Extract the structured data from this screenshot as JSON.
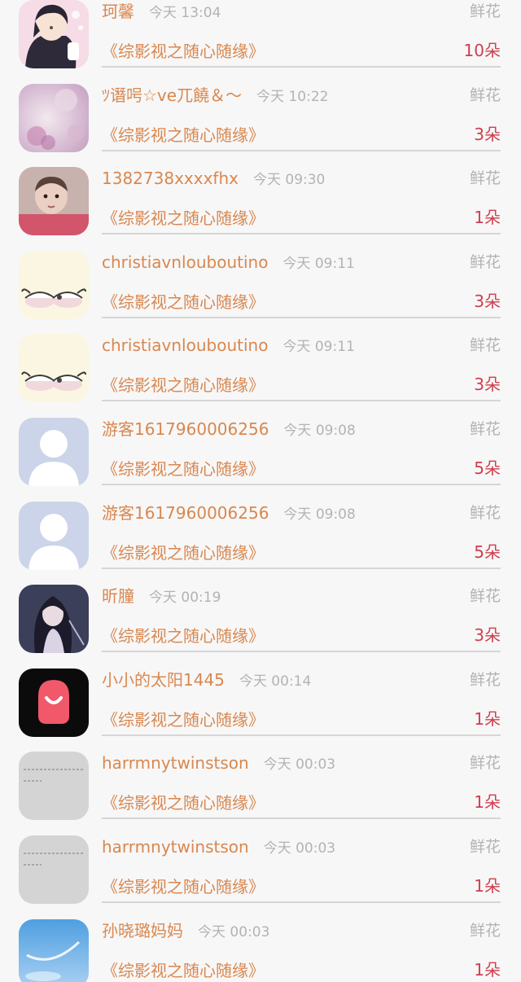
{
  "rows": [
    {
      "name": "珂馨",
      "time": "今天 13:04",
      "gift": "鲜花",
      "book": "《综影视之随心随缘》",
      "count": "10朵",
      "avatar_icon": "anime-boy-avatar"
    },
    {
      "name": "ﾂ谮呺☆ve兀饒＆～",
      "time": "今天 10:22",
      "gift": "鲜花",
      "book": "《综影视之随心随缘》",
      "count": "3朵",
      "avatar_icon": "flower-photo-avatar"
    },
    {
      "name": "1382738xxxxfhx",
      "time": "今天 09:30",
      "gift": "鲜花",
      "book": "《综影视之随心随缘》",
      "count": "1朵",
      "avatar_icon": "baby-photo-avatar"
    },
    {
      "name": "christiavnlouboutino",
      "time": "今天 09:11",
      "gift": "鲜花",
      "book": "《综影视之随心随缘》",
      "count": "3朵",
      "avatar_icon": "bunnies-avatar"
    },
    {
      "name": "christiavnlouboutino",
      "time": "今天 09:11",
      "gift": "鲜花",
      "book": "《综影视之随心随缘》",
      "count": "3朵",
      "avatar_icon": "bunnies-avatar"
    },
    {
      "name": "游客1617960006256",
      "time": "今天 09:08",
      "gift": "鲜花",
      "book": "《综影视之随心随缘》",
      "count": "5朵",
      "avatar_icon": "default-user-avatar"
    },
    {
      "name": "游客1617960006256",
      "time": "今天 09:08",
      "gift": "鲜花",
      "book": "《综影视之随心随缘》",
      "count": "5朵",
      "avatar_icon": "default-user-avatar"
    },
    {
      "name": "昕膧",
      "time": "今天 00:19",
      "gift": "鲜花",
      "book": "《综影视之随心随缘》",
      "count": "3朵",
      "avatar_icon": "anime-girl-avatar"
    },
    {
      "name": "小小的太阳1445",
      "time": "今天 00:14",
      "gift": "鲜花",
      "book": "《综影视之随心随缘》",
      "count": "1朵",
      "avatar_icon": "app-logo-avatar"
    },
    {
      "name": "harrmnytwinstson",
      "time": "今天 00:03",
      "gift": "鲜花",
      "book": "《综影视之随心随缘》",
      "count": "1朵",
      "avatar_icon": "handwriting-avatar"
    },
    {
      "name": "harrmnytwinstson",
      "time": "今天 00:03",
      "gift": "鲜花",
      "book": "《综影视之随心随缘》",
      "count": "1朵",
      "avatar_icon": "handwriting-avatar"
    },
    {
      "name": "孙晓璐妈妈",
      "time": "今天 00:03",
      "gift": "鲜花",
      "book": "《综影视之随心随缘》",
      "count": "1朵",
      "avatar_icon": "sky-avatar"
    }
  ],
  "colors": {
    "name": "#d9874f",
    "time": "#b3b3b3",
    "count": "#cf3e4e",
    "background": "#f7f7f7"
  }
}
